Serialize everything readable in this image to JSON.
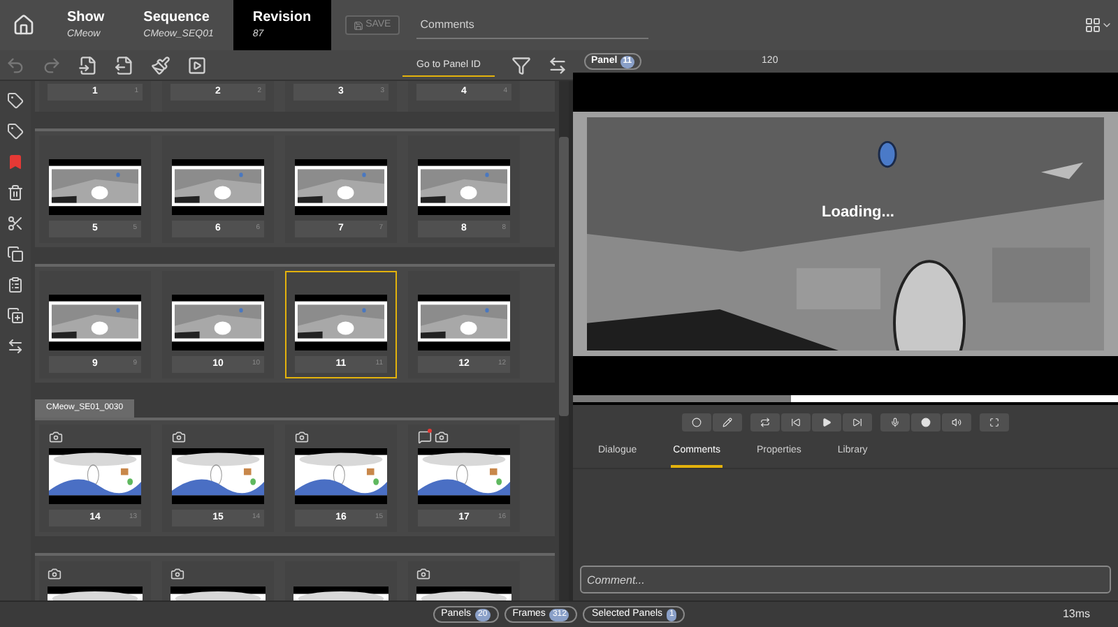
{
  "header": {
    "crumbs": [
      {
        "label": "Show",
        "value": "CMeow",
        "selected": false
      },
      {
        "label": "Sequence",
        "value": "CMeow_SEQ01",
        "selected": false
      },
      {
        "label": "Revision",
        "value": "87",
        "selected": true
      }
    ],
    "save": {
      "label": "SAVE",
      "disabled": true
    },
    "comments": {
      "placeholder": "Comments"
    }
  },
  "toolbar": {
    "goto": {
      "placeholder": "Go to Panel ID"
    }
  },
  "groups": [
    {
      "kind": "clipped_top",
      "cards": [
        {
          "number": "1",
          "frame": "1"
        },
        {
          "number": "2",
          "frame": "2"
        },
        {
          "number": "3",
          "frame": "3"
        },
        {
          "number": "4",
          "frame": "4"
        }
      ]
    },
    {
      "kind": "full",
      "cards": [
        {
          "number": "5",
          "frame": "5",
          "selected": false
        },
        {
          "number": "6",
          "frame": "6",
          "selected": false
        },
        {
          "number": "7",
          "frame": "7",
          "selected": false
        },
        {
          "number": "8",
          "frame": "8",
          "selected": false
        }
      ]
    },
    {
      "kind": "full",
      "cards": [
        {
          "number": "9",
          "frame": "9",
          "selected": false
        },
        {
          "number": "10",
          "frame": "10",
          "selected": false
        },
        {
          "number": "11",
          "frame": "11",
          "selected": true
        },
        {
          "number": "12",
          "frame": "12",
          "selected": false
        }
      ]
    },
    {
      "kind": "full",
      "scene": "CMeow_SE01_0030",
      "cards": [
        {
          "number": "14",
          "frame": "13",
          "selected": false,
          "camera": true,
          "comment": false
        },
        {
          "number": "15",
          "frame": "14",
          "selected": false,
          "camera": true,
          "comment": false
        },
        {
          "number": "16",
          "frame": "15",
          "selected": false,
          "camera": true,
          "comment": false
        },
        {
          "number": "17",
          "frame": "16",
          "selected": false,
          "camera": true,
          "comment": true
        }
      ]
    },
    {
      "kind": "clipped_bottom",
      "cards": [
        {
          "camera": true
        },
        {
          "camera": true
        },
        {
          "camera": false
        },
        {
          "camera": true
        }
      ]
    }
  ],
  "viewer": {
    "panel": {
      "label": "Panel",
      "count": "11"
    },
    "frame": "120",
    "loading": "Loading...",
    "progress": {
      "level": 0.4
    }
  },
  "tabs": [
    {
      "label": "Dialogue",
      "selected": false
    },
    {
      "label": "Comments",
      "selected": true
    },
    {
      "label": "Properties",
      "selected": false
    },
    {
      "label": "Library",
      "selected": false
    }
  ],
  "comment_field": {
    "placeholder": "Comment..."
  },
  "status_bar": {
    "badges": [
      {
        "label": "Panels",
        "count": "20"
      },
      {
        "label": "Frames",
        "count": "312"
      },
      {
        "label": "Selected Panels",
        "count": "1"
      }
    ],
    "time": "13ms"
  }
}
